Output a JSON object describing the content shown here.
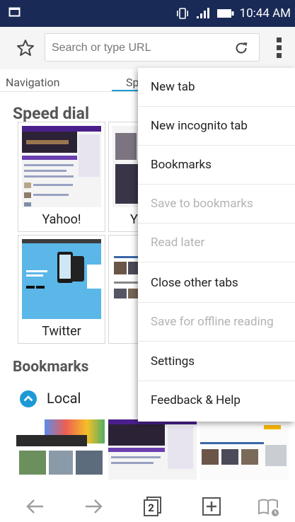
{
  "status": {
    "time": "10:44 AM"
  },
  "toolbar": {
    "search_placeholder": "Search or type URL"
  },
  "tabs": {
    "navigation": "Navigation",
    "speed_dial_partial": "Sp"
  },
  "speed_dial": {
    "title": "Speed dial",
    "tiles": [
      {
        "label": "Yahoo!"
      },
      {
        "label": "Yo"
      },
      {
        "label": "Twitter"
      }
    ]
  },
  "bookmarks": {
    "title": "Bookmarks",
    "folder": "Local"
  },
  "menu": {
    "items": [
      {
        "label": "New tab",
        "enabled": true
      },
      {
        "label": "New incognito tab",
        "enabled": true
      },
      {
        "label": "Bookmarks",
        "enabled": true
      },
      {
        "label": "Save to bookmarks",
        "enabled": false
      },
      {
        "label": "Read later",
        "enabled": false
      },
      {
        "label": "Close other tabs",
        "enabled": true
      },
      {
        "label": "Save for offline reading",
        "enabled": false
      },
      {
        "label": "Settings",
        "enabled": true
      },
      {
        "label": "Feedback & Help",
        "enabled": true
      }
    ]
  },
  "bottom": {
    "tab_count": "2"
  },
  "colors": {
    "status_bar": "#1a2a57",
    "accent": "#1d9ad6"
  }
}
